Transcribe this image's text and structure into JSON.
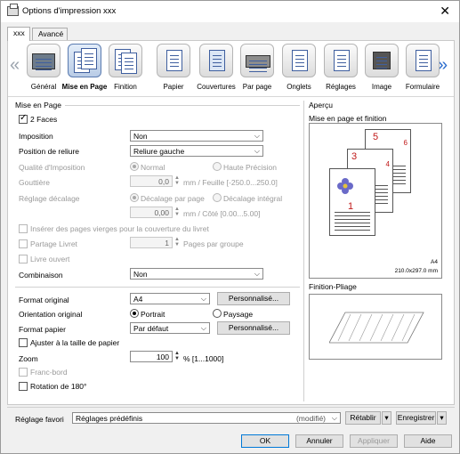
{
  "window": {
    "title": "Options d'impression xxx",
    "close": "✕"
  },
  "tabs": [
    "xxx",
    "Avancé"
  ],
  "categories": [
    {
      "label": "Général"
    },
    {
      "label": "Mise en Page"
    },
    {
      "label": "Finition"
    },
    {
      "label": "Papier"
    },
    {
      "label": "Couvertures"
    },
    {
      "label": "Par page"
    },
    {
      "label": "Onglets"
    },
    {
      "label": "Réglages"
    },
    {
      "label": "Image"
    },
    {
      "label": "Formulaire"
    }
  ],
  "arrows": {
    "left": "«",
    "right": "»"
  },
  "layout": {
    "group_title": "Mise en Page",
    "deux_faces": "2 Faces",
    "imposition_label": "Imposition",
    "imposition_value": "Non",
    "reliure_label": "Position de reliure",
    "reliure_value": "Reliure gauche",
    "qualite_label": "Qualité d'Imposition",
    "qualite_normal": "Normal",
    "qualite_haute": "Haute Précision",
    "gouttiere_label": "Gouttière",
    "gouttiere_value": "0,0",
    "gouttiere_unit": "mm / Feuille [-250.0...250.0]",
    "decalage_label": "Réglage décalage",
    "decalage_page": "Décalage par page",
    "decalage_integral": "Décalage intégral",
    "decalage_value": "0,00",
    "decalage_unit": "mm / Côté [0.00...5.00]",
    "inserer": "Insérer des pages vierges pour la couverture du livret",
    "partage": "Partage Livret",
    "partage_value": "1",
    "partage_unit": "Pages par groupe",
    "livret_ouvert": "Livre ouvert",
    "combinaison_label": "Combinaison",
    "combinaison_value": "Non"
  },
  "format": {
    "original_label": "Format original",
    "original_value": "A4",
    "original_btn": "Personnalisé...",
    "orientation_label": "Orientation original",
    "portrait": "Portrait",
    "paysage": "Paysage",
    "papier_label": "Format papier",
    "papier_value": "Par défaut",
    "papier_btn": "Personnalisé...",
    "ajuster": "Ajuster à la taille de papier",
    "zoom_label": "Zoom",
    "zoom_value": "100",
    "zoom_unit": "% [1...1000]",
    "franc_bord": "Franc-bord",
    "rotation": "Rotation de 180°"
  },
  "apercu": {
    "title": "Aperçu",
    "subtitle": "Mise en page et finition",
    "page_nums": [
      "5",
      "6",
      "3",
      "4",
      "1"
    ],
    "format": "A4",
    "dims": "210.0x297.0 mm",
    "finition_title": "Finition-Pliage"
  },
  "footer": {
    "favori_label": "Réglage favori",
    "favori_value": "Réglages prédéfinis",
    "favori_state": "(modifié)",
    "retablir": "Rétablir",
    "enregistrer": "Enregistrer",
    "ok": "OK",
    "annuler": "Annuler",
    "appliquer": "Appliquer",
    "aide": "Aide"
  }
}
